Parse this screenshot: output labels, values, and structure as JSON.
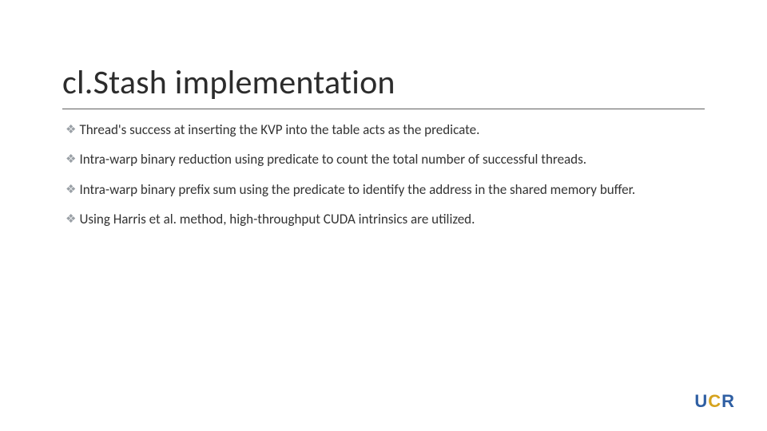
{
  "title": "cl.Stash implementation",
  "bullets": [
    "Thread's success at inserting the KVP into the table acts as the predicate.",
    "Intra-warp binary reduction using predicate to count the total number of successful threads.",
    "Intra-warp binary prefix sum using the predicate to identify the address in the shared memory buffer.",
    "Using Harris et al. method, high-throughput CUDA intrinsics are utilized."
  ],
  "bullet_marker": "❖",
  "logo": {
    "u": "U",
    "c": "C",
    "r": "R"
  }
}
